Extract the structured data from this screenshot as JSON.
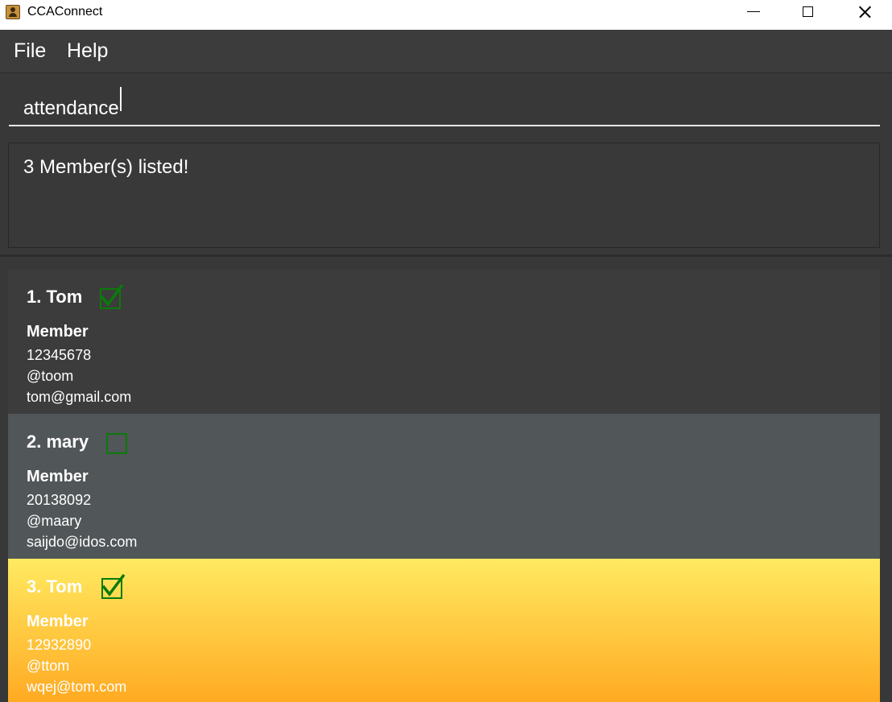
{
  "window": {
    "title": "CCAConnect"
  },
  "menu": {
    "file": "File",
    "help": "Help"
  },
  "command": {
    "value": "attendance"
  },
  "result": {
    "message": "3 Member(s) listed!"
  },
  "members": [
    {
      "name": "1. Tom",
      "attended": true,
      "role": "Member",
      "phone": "12345678",
      "telegram": "@toom",
      "email": "tom@gmail.com"
    },
    {
      "name": "2. mary",
      "attended": false,
      "role": "Member",
      "phone": "20138092",
      "telegram": "@maary",
      "email": "saijdo@idos.com"
    },
    {
      "name": "3. Tom",
      "attended": true,
      "role": "Member",
      "phone": "12932890",
      "telegram": "@ttom",
      "email": "wqej@tom.com",
      "selected": true
    }
  ],
  "colors": {
    "background": "#383838",
    "card_default": "#3c3c3c",
    "card_alternate": "#515658",
    "card_selected_top": "#ffea61",
    "card_selected_bottom": "#ffaa22",
    "checkbox_green": "#0a7a0a"
  }
}
